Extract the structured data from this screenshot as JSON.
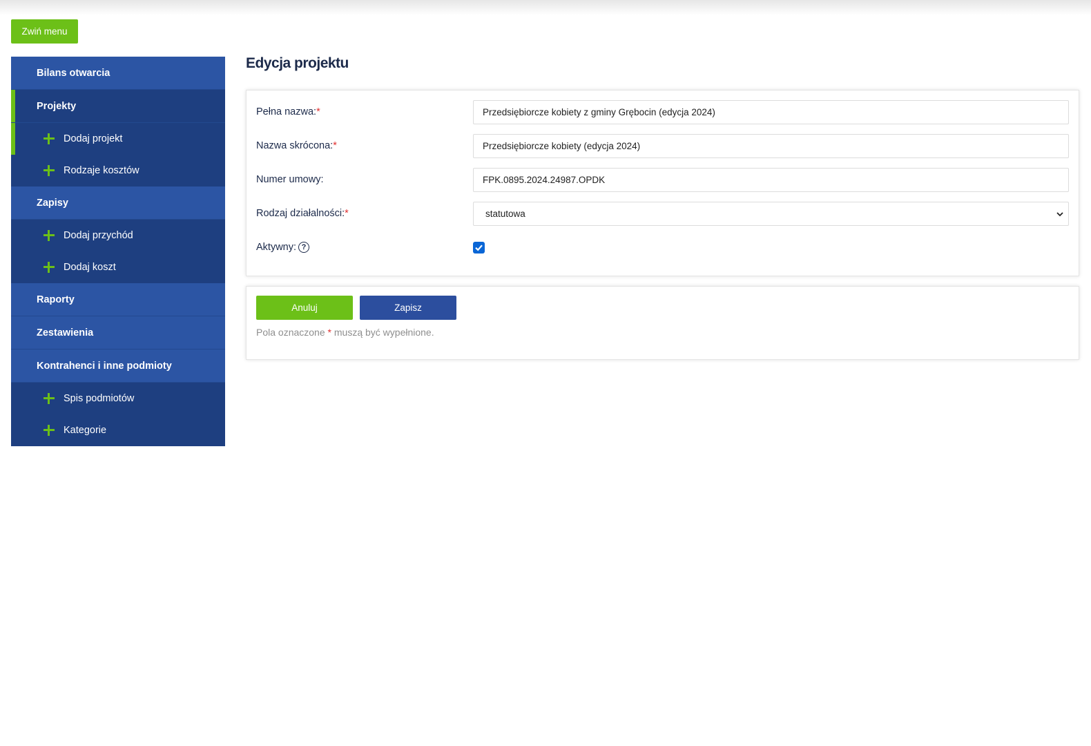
{
  "toolbar": {
    "collapse_label": "Zwiń menu"
  },
  "sidebar": {
    "items": [
      {
        "label": "Bilans otwarcia"
      },
      {
        "label": "Projekty"
      },
      {
        "label": "Dodaj projekt"
      },
      {
        "label": "Rodzaje kosztów"
      },
      {
        "label": "Zapisy"
      },
      {
        "label": "Dodaj przychód"
      },
      {
        "label": "Dodaj koszt"
      },
      {
        "label": "Raporty"
      },
      {
        "label": "Zestawienia"
      },
      {
        "label": "Kontrahenci i inne podmioty"
      },
      {
        "label": "Spis podmiotów"
      },
      {
        "label": "Kategorie"
      }
    ]
  },
  "page": {
    "title": "Edycja projektu"
  },
  "form": {
    "full_name": {
      "label": "Pełna nazwa:",
      "required": "*",
      "value": "Przedsiębiorcze kobiety z gminy Grębocin (edycja 2024)"
    },
    "short_name": {
      "label": "Nazwa skrócona:",
      "required": "*",
      "value": "Przedsiębiorcze kobiety (edycja 2024)"
    },
    "contract": {
      "label": "Numer umowy:",
      "value": "FPK.0895.2024.24987.OPDK"
    },
    "activity": {
      "label": "Rodzaj działalności:",
      "required": "*",
      "value": "statutowa"
    },
    "active": {
      "label": "Aktywny:",
      "help": "?",
      "checked": true
    }
  },
  "actions": {
    "cancel_label": "Anuluj",
    "save_label": "Zapisz",
    "hint_prefix": "Pola oznaczone",
    "hint_star": "*",
    "hint_suffix": "muszą być wypełnione."
  },
  "colors": {
    "accent": "#6cc018",
    "sidebar": "#2c55a4",
    "sidebar_dark": "#1e3f80",
    "primary": "#2c4e9e"
  }
}
